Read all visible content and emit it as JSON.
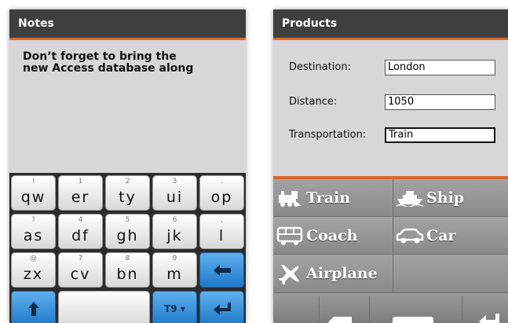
{
  "notes_screen": {
    "title": "Notes",
    "text_lines": [
      "Don’t forget to bring the",
      "new Access database along"
    ],
    "keyboard": {
      "row1": [
        {
          "num": "!",
          "letters": "qw"
        },
        {
          "num": "1",
          "letters": "er"
        },
        {
          "num": "2",
          "letters": "ty"
        },
        {
          "num": "3",
          "letters": "ui"
        },
        {
          "num": ".",
          "letters": "op"
        }
      ],
      "row2": [
        {
          "num": "?",
          "letters": "as"
        },
        {
          "num": "4",
          "letters": "df"
        },
        {
          "num": "5",
          "letters": "gh"
        },
        {
          "num": "6",
          "letters": "jk"
        },
        {
          "num": ",",
          "letters": "l"
        }
      ],
      "row3": [
        {
          "num": "@",
          "letters": "zx"
        },
        {
          "num": "7",
          "letters": "cv"
        },
        {
          "num": "8",
          "letters": "bn"
        },
        {
          "num": "9",
          "letters": "m"
        }
      ],
      "t9_label": "T9 ▾",
      "backspace_icon": "left-arrow-icon",
      "shift_icon": "up-arrow-icon",
      "enter_icon": "return-arrow-icon",
      "accent_color": "#2a8ae0"
    }
  },
  "products_screen": {
    "title": "Products",
    "fields": {
      "destination": {
        "label": "Destination:",
        "value": "London"
      },
      "distance": {
        "label": "Distance:",
        "value": "1050"
      },
      "transportation": {
        "label": "Transportation:",
        "value": "Train"
      }
    },
    "options": [
      {
        "label": "Train",
        "icon": "train-icon"
      },
      {
        "label": "Ship",
        "icon": "ship-icon"
      },
      {
        "label": "Coach",
        "icon": "coach-icon"
      },
      {
        "label": "Car",
        "icon": "car-icon"
      },
      {
        "label": "Airplane",
        "icon": "airplane-icon"
      }
    ],
    "accent_color": "#d9692a"
  }
}
